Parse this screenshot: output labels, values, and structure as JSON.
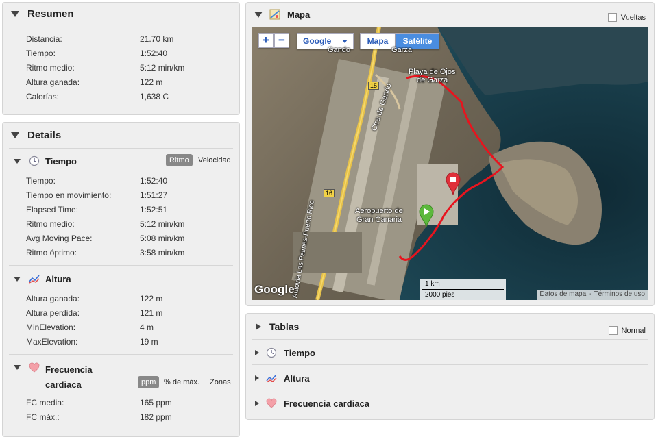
{
  "resumen": {
    "title": "Resumen",
    "rows": [
      {
        "label": "Distancia:",
        "value": "21.70 km"
      },
      {
        "label": "Tiempo:",
        "value": "1:52:40"
      },
      {
        "label": "Ritmo medio:",
        "value": "5:12 min/km"
      },
      {
        "label": "Altura ganada:",
        "value": "122 m"
      },
      {
        "label": "Calorías:",
        "value": "1,638 C"
      }
    ]
  },
  "details": {
    "title": "Details",
    "tiempo": {
      "title": "Tiempo",
      "btn_ritmo": "Ritmo",
      "btn_velocidad": "Velocidad",
      "rows": [
        {
          "label": "Tiempo:",
          "value": "1:52:40"
        },
        {
          "label": "Tiempo en movimiento:",
          "value": "1:51:27"
        },
        {
          "label": "Elapsed Time:",
          "value": "1:52:51"
        },
        {
          "label": "Ritmo medio:",
          "value": "5:12 min/km"
        },
        {
          "label": "Avg Moving Pace:",
          "value": "5:08 min/km"
        },
        {
          "label": "Ritmo óptimo:",
          "value": "3:58 min/km"
        }
      ]
    },
    "altura": {
      "title": "Altura",
      "rows": [
        {
          "label": "Altura ganada:",
          "value": "122 m"
        },
        {
          "label": "Altura perdida:",
          "value": "121 m"
        },
        {
          "label": "MinElevation:",
          "value": "4 m"
        },
        {
          "label": "MaxElevation:",
          "value": "19 m"
        }
      ]
    },
    "fc": {
      "title_line1": "Frecuencia",
      "title_line2": "cardiaca",
      "btn_ppm": "ppm",
      "btn_pct": "% de máx.",
      "btn_zonas": "Zonas",
      "rows": [
        {
          "label": "FC media:",
          "value": "165 ppm"
        },
        {
          "label": "FC máx.:",
          "value": "182 ppm"
        }
      ]
    }
  },
  "mapa": {
    "title": "Mapa",
    "vueltas": "Vueltas",
    "provider": "Google",
    "type_mapa": "Mapa",
    "type_satelite": "Satélite",
    "labels": {
      "playa": "Playa de Ojos",
      "playa2": "de Garza",
      "aeropuerto": "Aeropuerto de",
      "aeropuerto2": "Gran Canaria",
      "road15": "15",
      "road16": "16",
      "ctra": "Ctra de Gando",
      "gando": "Gando",
      "garza": "Garza",
      "autovia": "Autovía Las Palmas-Puerto Rico"
    },
    "scale_km": "1 km",
    "scale_ft": "2000 pies",
    "logo": "Google",
    "datos": "Datos de mapa",
    "terminos": "Términos de uso",
    "sep": "-"
  },
  "tablas": {
    "title": "Tablas",
    "normal": "Normal",
    "items": [
      "Tiempo",
      "Altura",
      "Frecuencia cardiaca"
    ]
  }
}
